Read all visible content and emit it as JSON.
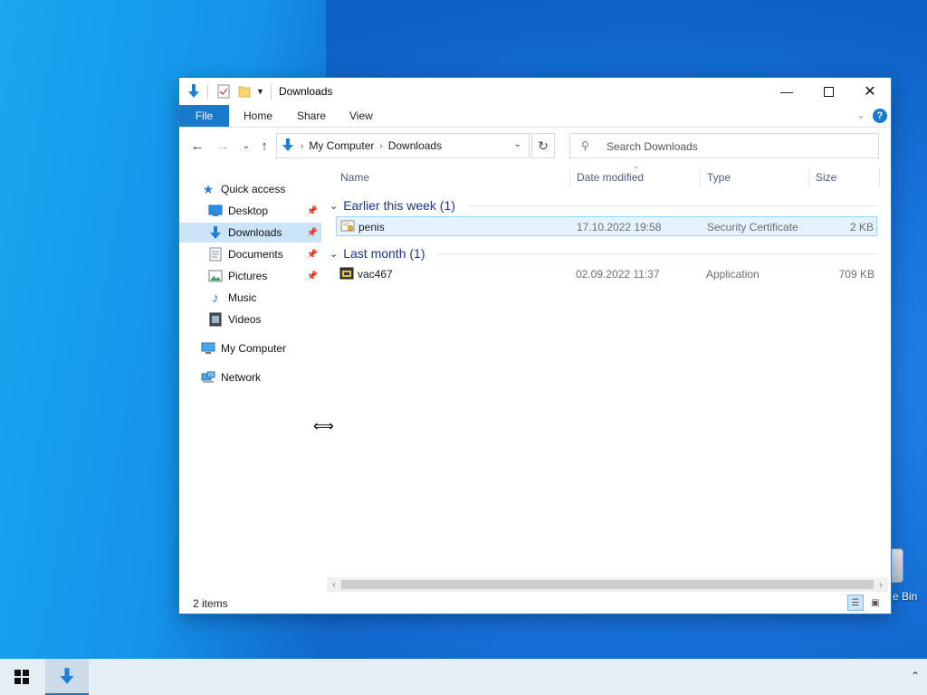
{
  "desktop": {
    "recycle_bin_label": "e Bin"
  },
  "window": {
    "title": "Downloads",
    "ribbon_tabs": [
      "File",
      "Home",
      "Share",
      "View"
    ],
    "help_label": "?",
    "address": {
      "crumbs": [
        "My Computer",
        "Downloads"
      ]
    },
    "search_placeholder": "Search Downloads",
    "nav": {
      "quick_access": "Quick access",
      "items": [
        {
          "label": "Desktop",
          "pinned": true
        },
        {
          "label": "Downloads",
          "pinned": true,
          "selected": true
        },
        {
          "label": "Documents",
          "pinned": true
        },
        {
          "label": "Pictures",
          "pinned": true
        },
        {
          "label": "Music",
          "pinned": false
        },
        {
          "label": "Videos",
          "pinned": false
        }
      ],
      "my_computer": "My Computer",
      "network": "Network"
    },
    "columns": {
      "name": "Name",
      "date": "Date modified",
      "type": "Type",
      "size": "Size"
    },
    "groups": [
      {
        "label": "Earlier this week (1)",
        "files": [
          {
            "name": "penis",
            "date": "17.10.2022 19:58",
            "type": "Security Certificate",
            "size": "2 KB",
            "icon": "certificate-icon"
          }
        ]
      },
      {
        "label": "Last month (1)",
        "files": [
          {
            "name": "vac467",
            "date": "02.09.2022 11:37",
            "type": "Application",
            "size": "709 KB",
            "icon": "application-icon"
          }
        ]
      }
    ],
    "status": {
      "item_count": "2 items"
    }
  },
  "colors": {
    "accent": "#1979ca",
    "selection": "#cce4f7",
    "group_text": "#1e3287"
  }
}
